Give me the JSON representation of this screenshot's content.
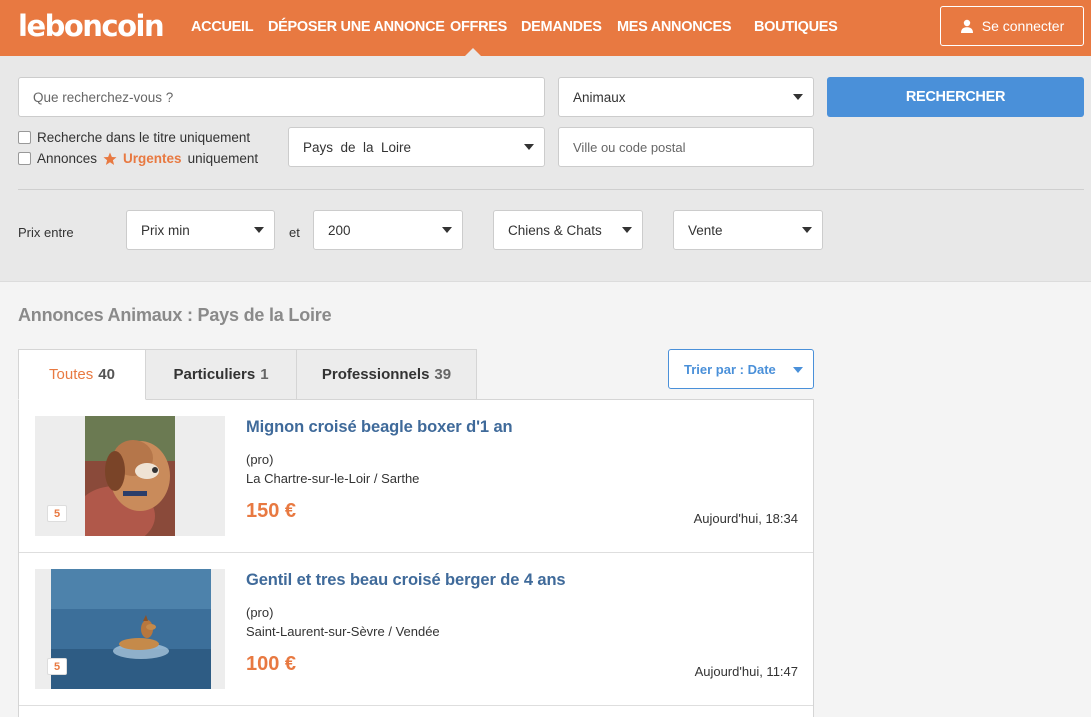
{
  "header": {
    "logo": "leboncoin",
    "nav": [
      {
        "label": "ACCUEIL"
      },
      {
        "label": "DÉPOSER UNE ANNONCE"
      },
      {
        "label": "OFFRES"
      },
      {
        "label": "DEMANDES"
      },
      {
        "label": "MES ANNONCES"
      },
      {
        "label": "BOUTIQUES"
      }
    ],
    "active_nav": "OFFRES",
    "connect_label": "Se connecter"
  },
  "search": {
    "query_placeholder": "Que recherchez-vous ?",
    "category": "Animaux",
    "button_label": "RECHERCHER",
    "title_only_label": "Recherche dans le titre uniquement",
    "urgent_prefix": "Annonces",
    "urgent_word": "Urgentes",
    "urgent_suffix": "uniquement",
    "region": "Pays  de  la  Loire",
    "city_placeholder": "Ville ou code postal",
    "price_label": "Prix entre",
    "price_min": "Prix min",
    "price_and": "et",
    "price_max": "200",
    "subcategory": "Chiens & Chats",
    "type": "Vente"
  },
  "results": {
    "title": "Annonces Animaux : Pays de la Loire",
    "tabs": [
      {
        "label": "Toutes",
        "count": "40"
      },
      {
        "label": "Particuliers",
        "count": "1"
      },
      {
        "label": "Professionnels",
        "count": "39"
      }
    ],
    "sort_label": "Trier par : Date",
    "ads": [
      {
        "title": "Mignon croisé beagle boxer d'1 an",
        "seller": "(pro)",
        "location": "La Chartre-sur-le-Loir / Sarthe",
        "price": "150 €",
        "date": "Aujourd'hui, 18:34",
        "photos": "5"
      },
      {
        "title": "Gentil et tres beau croisé berger de 4 ans",
        "seller": "(pro)",
        "location": "Saint-Laurent-sur-Sèvre / Vendée",
        "price": "100 €",
        "date": "Aujourd'hui, 11:47",
        "photos": "5"
      }
    ]
  },
  "colors": {
    "brand": "#e87941",
    "link": "#3f6a9a",
    "button": "#4a90d9"
  }
}
